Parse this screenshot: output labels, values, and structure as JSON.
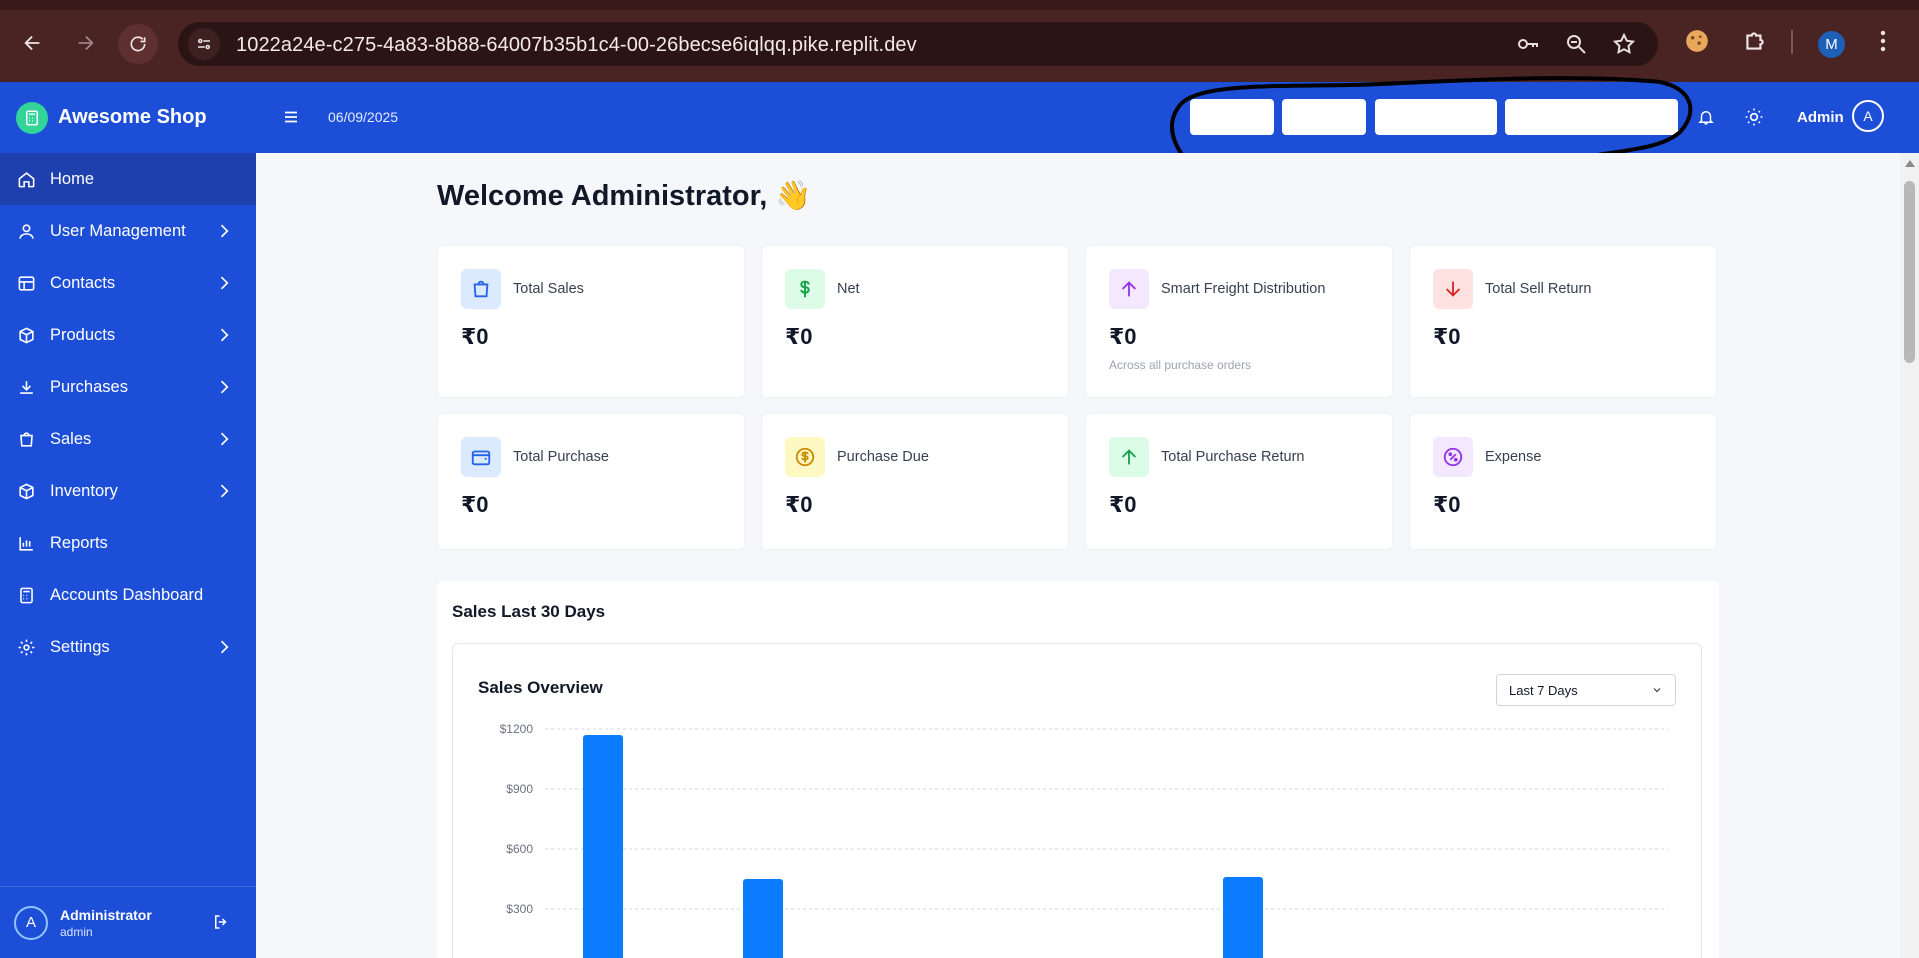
{
  "browser": {
    "url": "1022a24e-c275-4a83-8b88-64007b35b1c4-00-26becse6iqlqq.pike.replit.dev",
    "profile_initial": "M"
  },
  "brand": {
    "name": "Awesome Shop"
  },
  "header": {
    "date": "06/09/2025",
    "user_label": "Admin",
    "user_initial": "A"
  },
  "sidebar": {
    "items": [
      {
        "label": "Home",
        "icon": "home-icon"
      },
      {
        "label": "User Management",
        "icon": "user-icon"
      },
      {
        "label": "Contacts",
        "icon": "contacts-icon"
      },
      {
        "label": "Products",
        "icon": "box-icon"
      },
      {
        "label": "Purchases",
        "icon": "download-icon"
      },
      {
        "label": "Sales",
        "icon": "bag-icon"
      },
      {
        "label": "Inventory",
        "icon": "package-icon"
      },
      {
        "label": "Reports",
        "icon": "bar-chart-icon"
      },
      {
        "label": "Accounts Dashboard",
        "icon": "calculator-icon"
      },
      {
        "label": "Settings",
        "icon": "gear-icon"
      }
    ],
    "footer": {
      "name": "Administrator",
      "role": "admin",
      "initial": "A"
    }
  },
  "welcome": "Welcome Administrator, 👋",
  "cards": [
    {
      "label": "Total Sales",
      "value": "₹0",
      "icon": "shopping-bag-icon",
      "color": "#2563eb",
      "bg": "#dbeafe"
    },
    {
      "label": "Net",
      "value": "₹0",
      "icon": "dollar-icon",
      "color": "#16a34a",
      "bg": "#dcfce7"
    },
    {
      "label": "Smart Freight Distribution",
      "value": "₹0",
      "sub": "Across all purchase orders",
      "icon": "arrow-up-icon",
      "color": "#9333ea",
      "bg": "#f3e8ff"
    },
    {
      "label": "Total Sell Return",
      "value": "₹0",
      "icon": "arrow-down-icon",
      "color": "#dc2626",
      "bg": "#fee2e2"
    },
    {
      "label": "Total Purchase",
      "value": "₹0",
      "icon": "wallet-icon",
      "color": "#2563eb",
      "bg": "#dbeafe"
    },
    {
      "label": "Purchase Due",
      "value": "₹0",
      "icon": "coin-icon",
      "color": "#ca8a04",
      "bg": "#fef9c3"
    },
    {
      "label": "Total Purchase Return",
      "value": "₹0",
      "icon": "arrow-up-icon",
      "color": "#16a34a",
      "bg": "#dcfce7"
    },
    {
      "label": "Expense",
      "value": "₹0",
      "icon": "percent-badge-icon",
      "color": "#9333ea",
      "bg": "#f3e8ff"
    }
  ],
  "sales": {
    "section_title": "Sales Last 30 Days",
    "overview_title": "Sales Overview",
    "range": "Last 7 Days"
  },
  "chart_data": {
    "type": "bar",
    "title": "Sales Overview",
    "xlabel": "",
    "ylabel": "",
    "ylim": [
      0,
      1200
    ],
    "yticks": [
      "$1200",
      "$900",
      "$600",
      "$300"
    ],
    "bar_color": "#0b7cff",
    "values": [
      1170,
      450,
      0,
      0,
      460,
      0,
      0
    ],
    "grid": true
  }
}
